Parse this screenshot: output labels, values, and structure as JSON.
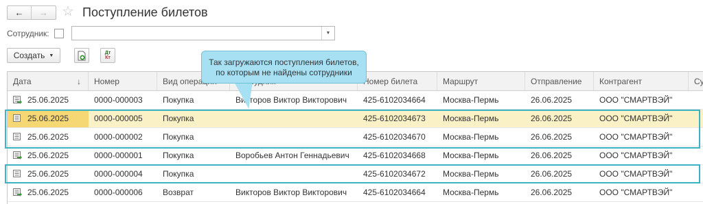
{
  "header": {
    "back_icon": "arrow-left-icon",
    "forward_icon": "arrow-right-icon",
    "favorite_icon": "star-icon",
    "title": "Поступление билетов"
  },
  "filter": {
    "label": "Сотрудник:",
    "checked": false,
    "value": ""
  },
  "toolbar": {
    "create_label": "Создать",
    "dt_label": "Дт",
    "kt_label": "Кт"
  },
  "columns": [
    "Дата",
    "Номер",
    "Вид операции",
    "Сотрудник",
    "Номер билета",
    "Маршрут",
    "Отправление",
    "Контрагент",
    "Су"
  ],
  "rows": [
    {
      "date": "25.06.2025",
      "number": "0000-000003",
      "type": "Покупка",
      "employee": "Викторов Виктор Викторович",
      "ticket": "425-6102034664",
      "route": "Москва-Пермь",
      "departure": "26.06.2025",
      "contractor": "ООО \"СМАРТВЭЙ\"",
      "posted": true
    },
    {
      "date": "25.06.2025",
      "number": "0000-000005",
      "type": "Покупка",
      "employee": "",
      "ticket": "425-6102034673",
      "route": "Москва-Пермь",
      "departure": "26.06.2025",
      "contractor": "ООО \"СМАРТВЭЙ\"",
      "posted": false,
      "selected": true
    },
    {
      "date": "25.06.2025",
      "number": "0000-000002",
      "type": "Покупка",
      "employee": "",
      "ticket": "425-6102034670",
      "route": "Москва-Пермь",
      "departure": "26.06.2025",
      "contractor": "ООО \"СМАРТВЭЙ\"",
      "posted": false
    },
    {
      "date": "25.06.2025",
      "number": "0000-000001",
      "type": "Покупка",
      "employee": "Воробьев Антон Геннадьевич",
      "ticket": "425-6102034668",
      "route": "Москва-Пермь",
      "departure": "26.06.2025",
      "contractor": "ООО \"СМАРТВЭЙ\"",
      "posted": true
    },
    {
      "date": "25.06.2025",
      "number": "0000-000004",
      "type": "Покупка",
      "employee": "",
      "ticket": "425-6102034672",
      "route": "Москва-Пермь",
      "departure": "26.06.2025",
      "contractor": "ООО \"СМАРТВЭЙ\"",
      "posted": false
    },
    {
      "date": "25.06.2025",
      "number": "0000-000006",
      "type": "Возврат",
      "employee": "Викторов Виктор Викторович",
      "ticket": "425-6102034664",
      "route": "Москва-Пермь",
      "departure": "26.06.2025",
      "contractor": "ООО \"СМАРТВЭЙ\"",
      "posted": true
    }
  ],
  "callout": {
    "line1": "Так загружаются поступления билетов,",
    "line2": "по которым не найдены сотрудники"
  },
  "colors": {
    "highlight": "#3bb3c3",
    "callout_bg": "#a8e0f3",
    "selected_row": "#fbf1c6"
  }
}
